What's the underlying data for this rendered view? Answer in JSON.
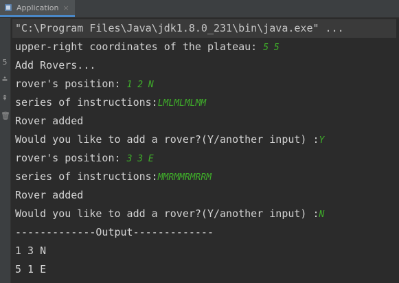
{
  "tab": {
    "label": "Application",
    "close_glyph": "×"
  },
  "gutter": {
    "icons": [
      "5",
      "≛",
      "⇞",
      "🗑"
    ]
  },
  "console": {
    "command": "\"C:\\Program Files\\Java\\jdk1.8.0_231\\bin\\java.exe\" ...",
    "lines": [
      {
        "prompt": "upper-right coordinates of the plateau: ",
        "input": "5 5"
      },
      {
        "prompt": "Add Rovers...",
        "input": ""
      },
      {
        "prompt": "rover's position: ",
        "input": "1 2 N"
      },
      {
        "prompt": "series of instructions:",
        "input": "LMLMLMLMM"
      },
      {
        "prompt": "Rover added",
        "input": ""
      },
      {
        "prompt": "Would you like to add a rover?(Y/another input) :",
        "input": "Y"
      },
      {
        "prompt": "rover's position: ",
        "input": "3 3 E"
      },
      {
        "prompt": "series of instructions:",
        "input": "MMRMMRMRRM"
      },
      {
        "prompt": "Rover added",
        "input": ""
      },
      {
        "prompt": "Would you like to add a rover?(Y/another input) :",
        "input": "N"
      },
      {
        "prompt": "-------------Output-------------",
        "input": ""
      },
      {
        "prompt": "1 3 N",
        "input": ""
      },
      {
        "prompt": "5 1 E",
        "input": ""
      }
    ]
  },
  "colors": {
    "background": "#2b2b2b",
    "text": "#d4d4d4",
    "user_input": "#3fae2a",
    "tab_accent": "#4a88c7"
  }
}
